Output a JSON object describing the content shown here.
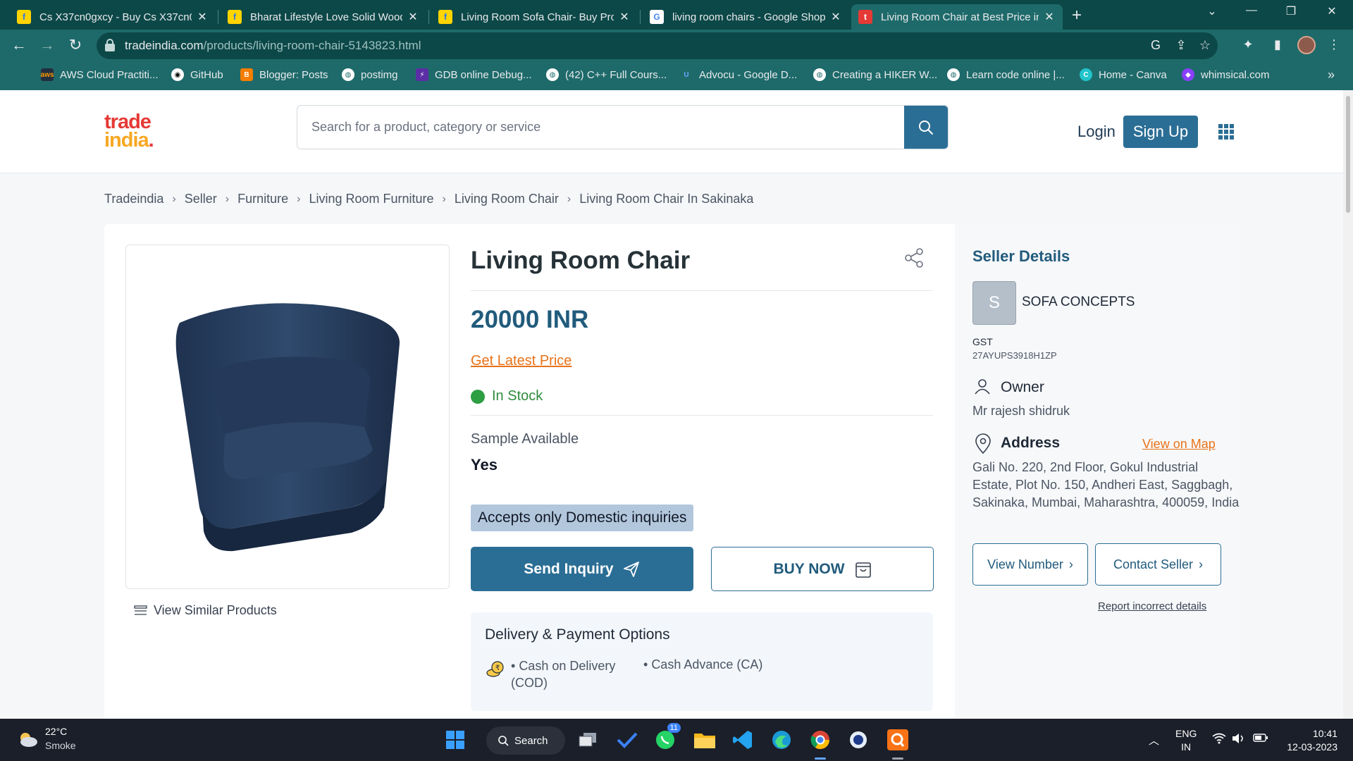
{
  "browser": {
    "tabs": [
      {
        "title": "Cs X37cn0gxcy - Buy Cs X37cn0g",
        "favicon": "flipkart-icon",
        "active": false
      },
      {
        "title": "Bharat Lifestyle Love Solid Wood",
        "favicon": "flipkart-icon",
        "active": false
      },
      {
        "title": "Living Room Sofa Chair- Buy Proc",
        "favicon": "flipkart-icon",
        "active": false
      },
      {
        "title": "living room chairs - Google Shop",
        "favicon": "google-icon",
        "active": false
      },
      {
        "title": "Living Room Chair at Best Price in",
        "favicon": "tradeindia-icon",
        "active": true
      }
    ],
    "url_domain": "tradeindia.com",
    "url_path": "/products/living-room-chair-5143823.html",
    "bookmarks": [
      {
        "label": "AWS Cloud Practiti...",
        "icon": "aws-icon"
      },
      {
        "label": "GitHub",
        "icon": "github-icon"
      },
      {
        "label": "Blogger: Posts",
        "icon": "blogger-icon"
      },
      {
        "label": "postimg",
        "icon": "globe-icon"
      },
      {
        "label": "GDB online Debug...",
        "icon": "gdb-icon"
      },
      {
        "label": "(42) C++ Full Cours...",
        "icon": "globe-icon"
      },
      {
        "label": "Advocu - Google D...",
        "icon": "advocu-icon"
      },
      {
        "label": "Creating a HIKER W...",
        "icon": "globe-icon"
      },
      {
        "label": "Learn code online |...",
        "icon": "globe-icon"
      },
      {
        "label": "Home - Canva",
        "icon": "canva-icon"
      },
      {
        "label": "whimsical.com",
        "icon": "whimsical-icon"
      }
    ],
    "bookmarks_more": "»"
  },
  "header": {
    "logo_line1": "trade",
    "logo_line2": "india",
    "logo_dot": ".",
    "search_placeholder": "Search for a product, category or service",
    "login_label": "Login",
    "signup_label": "Sign Up"
  },
  "breadcrumb": [
    "Tradeindia",
    "Seller",
    "Furniture",
    "Living Room Furniture",
    "Living Room Chair",
    "Living Room Chair In Sakinaka"
  ],
  "product": {
    "title": "Living Room Chair",
    "price": "20000 INR",
    "get_latest_price": "Get Latest Price",
    "stock_status": "In Stock",
    "sample_label": "Sample Available",
    "sample_value": "Yes",
    "domestic_note": "Accepts only Domestic inquiries",
    "send_inquiry_label": "Send Inquiry",
    "buy_now_label": "BUY NOW",
    "view_similar_label": "View Similar Products",
    "delivery_title": "Delivery & Payment Options",
    "payment_options": [
      "Cash on Delivery (COD)",
      "Cash Advance (CA)"
    ],
    "chair_color": "#2a3f5c"
  },
  "seller": {
    "section_title": "Seller Details",
    "initial": "S",
    "name": "SOFA CONCEPTS",
    "gst_label": "GST",
    "gst_value": "27AYUPS3918H1ZP",
    "owner_label": "Owner",
    "owner_value": "Mr rajesh shidruk",
    "address_label": "Address",
    "view_on_map": "View on Map",
    "address_value": "Gali No. 220, 2nd Floor, Gokul Industrial Estate, Plot No. 150, Andheri East, Saggbagh, Sakinaka, Mumbai, Maharashtra, 400059, India",
    "view_number_label": "View Number",
    "contact_seller_label": "Contact Seller",
    "report_label": "Report incorrect details"
  },
  "taskbar": {
    "temperature": "22°C",
    "condition": "Smoke",
    "search_label": "Search",
    "whatsapp_badge": "11",
    "lang_line1": "ENG",
    "lang_line2": "IN",
    "time": "10:41",
    "date": "12-03-2023"
  },
  "colors": {
    "chrome_frame": "#0d4848",
    "chrome_toolbar": "#1e6a6a",
    "brand_blue": "#2b6e95",
    "price_blue": "#215b7c",
    "accent_orange": "#e8731a",
    "stock_green": "#2e9e43",
    "logo_red": "#e53935",
    "logo_yellow": "#f7a823"
  }
}
